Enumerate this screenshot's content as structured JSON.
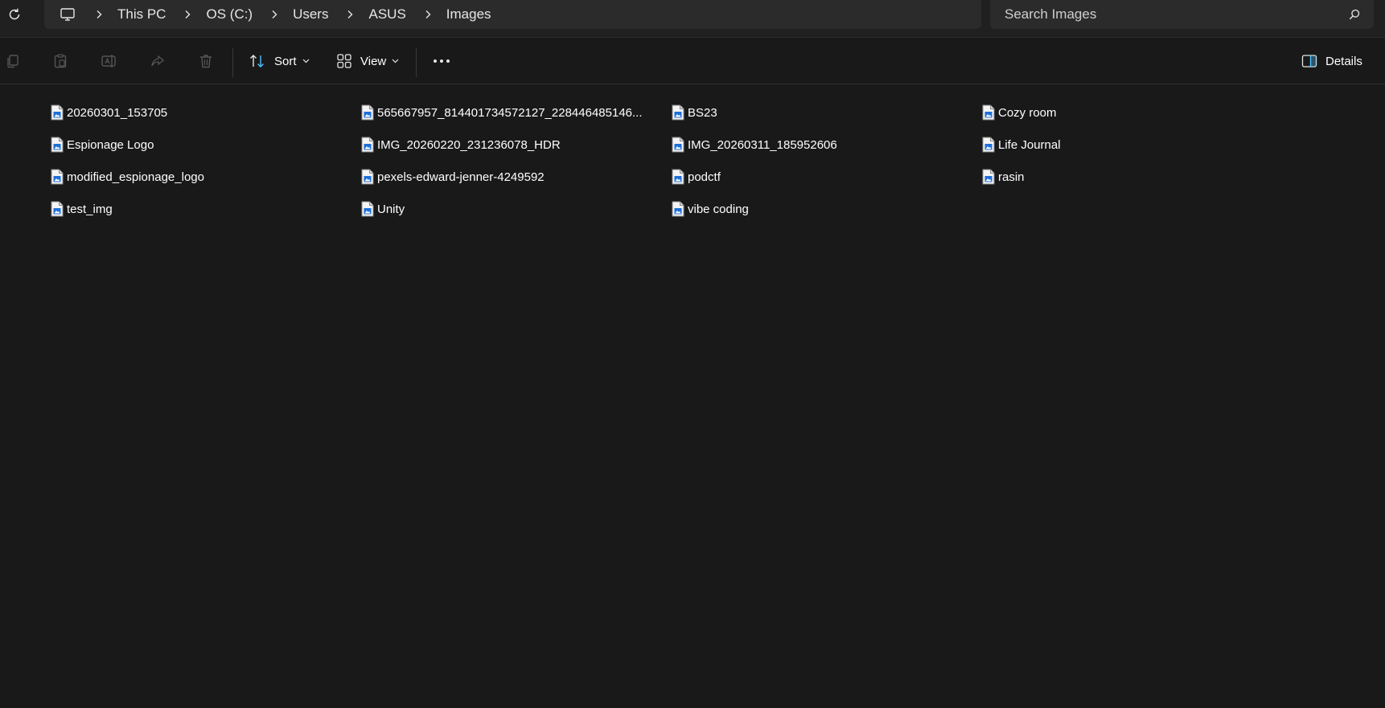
{
  "breadcrumb": {
    "items": [
      "This PC",
      "OS (C:)",
      "Users",
      "ASUS",
      "Images"
    ]
  },
  "search": {
    "placeholder": "Search Images"
  },
  "toolbar": {
    "sort_label": "Sort",
    "view_label": "View",
    "details_label": "Details"
  },
  "files": [
    {
      "name": "20260301_153705"
    },
    {
      "name": "565667957_814401734572127_228446485146..."
    },
    {
      "name": "BS23"
    },
    {
      "name": "Cozy room"
    },
    {
      "name": "Espionage Logo"
    },
    {
      "name": "IMG_20260220_231236078_HDR"
    },
    {
      "name": "IMG_20260311_185952606"
    },
    {
      "name": "Life Journal"
    },
    {
      "name": "modified_espionage_logo"
    },
    {
      "name": "pexels-edward-jenner-4249592"
    },
    {
      "name": "podctf"
    },
    {
      "name": "rasin"
    },
    {
      "name": "test_img"
    },
    {
      "name": "Unity"
    },
    {
      "name": "vibe coding"
    }
  ],
  "colors": {
    "background": "#191919",
    "bar": "#2b2b2b",
    "accent": "#4cc2ff",
    "text": "#ffffff",
    "icon_muted": "#5a5a5a"
  }
}
